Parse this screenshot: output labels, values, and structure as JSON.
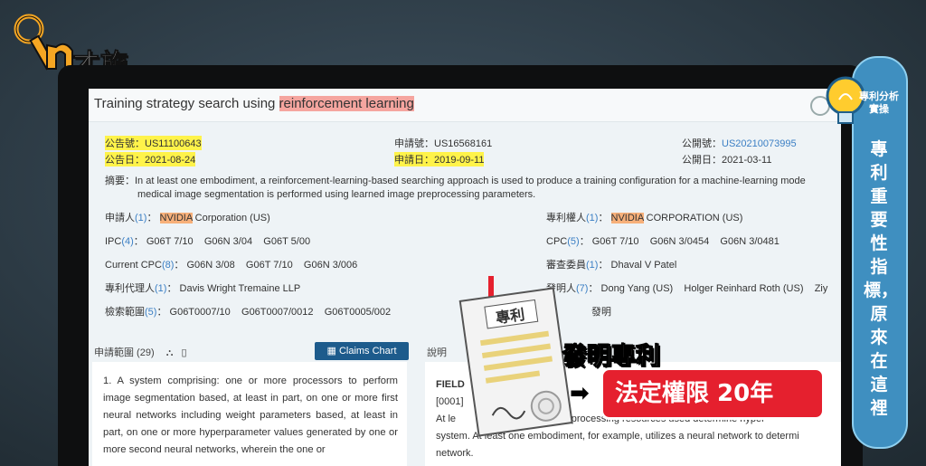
{
  "brand": {
    "logo_text": "才施教"
  },
  "doc": {
    "title_prefix": "Training strategy search using ",
    "title_highlight": "reinforcement learning",
    "announce_no_label": "公告號：",
    "announce_no": "US11100643",
    "announce_date_label": "公告日：",
    "announce_date": "2021-08-24",
    "app_no_label": "申請號：",
    "app_no": "US16568161",
    "app_date_label": "申請日：",
    "app_date": "2019-09-11",
    "pub_no_label": "公開號：",
    "pub_no": "US20210073995",
    "pub_date_label": "公開日：",
    "pub_date": "2021-03-11",
    "abstract_label": "摘要：",
    "abstract_line1": "In at least one embodiment, a reinforcement-learning-based searching approach is used to produce a training configuration for a machine-learning mode",
    "abstract_line2": "medical image segmentation is performed using learned image preprocessing parameters.",
    "applicant_label": "申請人",
    "applicant_count": "(1)",
    "applicant_hl": "NVIDIA",
    "applicant_rest": " Corporation (US)",
    "assignee_label": "專利權人",
    "assignee_count": "(1)",
    "assignee_hl": "NVIDIA",
    "assignee_rest": " CORPORATION (US)",
    "ipc_label": "IPC",
    "ipc_count": "(4)",
    "ipc_values": "G06T 7/10    G06N 3/04    G06T 5/00",
    "cpc_label": "CPC",
    "cpc_count": "(5)",
    "cpc_values": "G06T 7/10    G06N 3/0454    G06N 3/0481",
    "current_cpc_label": "Current CPC",
    "current_cpc_count": "(8)",
    "current_cpc_values": "G06N 3/08    G06T 7/10    G06N 3/006",
    "examiner_label": "審查委員",
    "examiner_count": "(1)",
    "examiner_value": "Dhaval V Patel",
    "agent_label": "專利代理人",
    "agent_count": "(1)",
    "agent_value": "Davis Wright Tremaine LLP",
    "inventor_label": "發明人",
    "inventor_count": "(7)",
    "inventor_value": "Dong Yang (US)    Holger Reinhard Roth (US)    Ziy",
    "search_scope_label": "檢索範圍",
    "search_scope_count": "(5)",
    "search_scope_values": "G06T0007/10    G06T0007/0012    G06T0005/002",
    "type_value": "發明"
  },
  "claims": {
    "header": "申請範圍 (29)",
    "button_label": "Claims Chart",
    "text": "1. A system comprising: one or more processors to perform image segmentation based, at least in part, on one or more first neural networks including weight parameters based, at least in part, on one or more hyperparameter values generated by one or more second neural networks, wherein the one or"
  },
  "description": {
    "header": "說明",
    "field_label": "FIELD",
    "line1": "[0001]",
    "line2": "At le                        pertains to processing resources used determine hyper",
    "line3": "system. At least one embodiment, for example, utilizes a neural network to determi",
    "line4": "network."
  },
  "overlay": {
    "paper_label": "專利",
    "caption_top": "發明專利",
    "caption_red": "法定權限 20年"
  },
  "side": {
    "tag": "專利分析實操",
    "vertical_text": "專利重要性指標，原來在這裡"
  }
}
